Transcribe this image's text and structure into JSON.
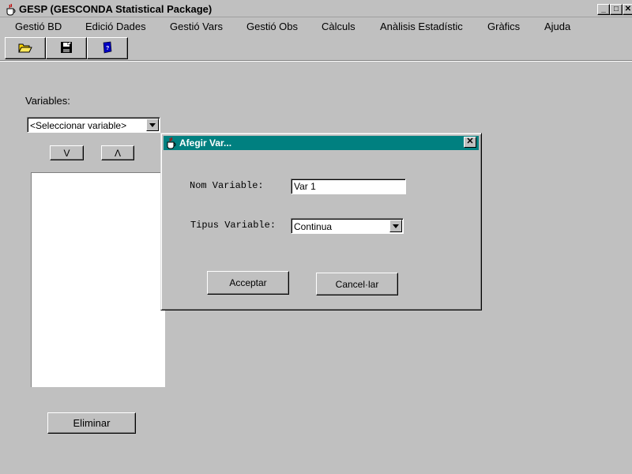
{
  "window": {
    "title": "GESP (GESCONDA Statistical Package)",
    "minimize_label": "_",
    "maximize_label": "□",
    "close_label": "✕"
  },
  "menu": [
    {
      "label": "Gestió BD"
    },
    {
      "label": "Edició Dades"
    },
    {
      "label": "Gestió Vars"
    },
    {
      "label": "Gestió Obs"
    },
    {
      "label": "Càlculs"
    },
    {
      "label": "Anàlisis Estadístic"
    },
    {
      "label": "Gràfics"
    },
    {
      "label": "Ajuda"
    }
  ],
  "toolbar": {
    "icons": [
      "open-folder-icon",
      "save-disk-icon",
      "help-book-icon"
    ]
  },
  "main": {
    "variables_label": "Variables:",
    "variable_select_value": "<Seleccionar variable>",
    "down_button_label": "V",
    "up_button_label": "Λ",
    "delete_button_label": "Eliminar"
  },
  "dialog": {
    "title": "Afegir Var...",
    "close_label": "✕",
    "name_label": "Nom Variable:",
    "name_value": "Var 1",
    "type_label": "Tipus Variable:",
    "type_value": "Continua",
    "accept_label": "Acceptar",
    "cancel_label": "Cancel·lar"
  },
  "colors": {
    "background": "#c0c0c0",
    "dialog_title_bar": "#008080"
  }
}
